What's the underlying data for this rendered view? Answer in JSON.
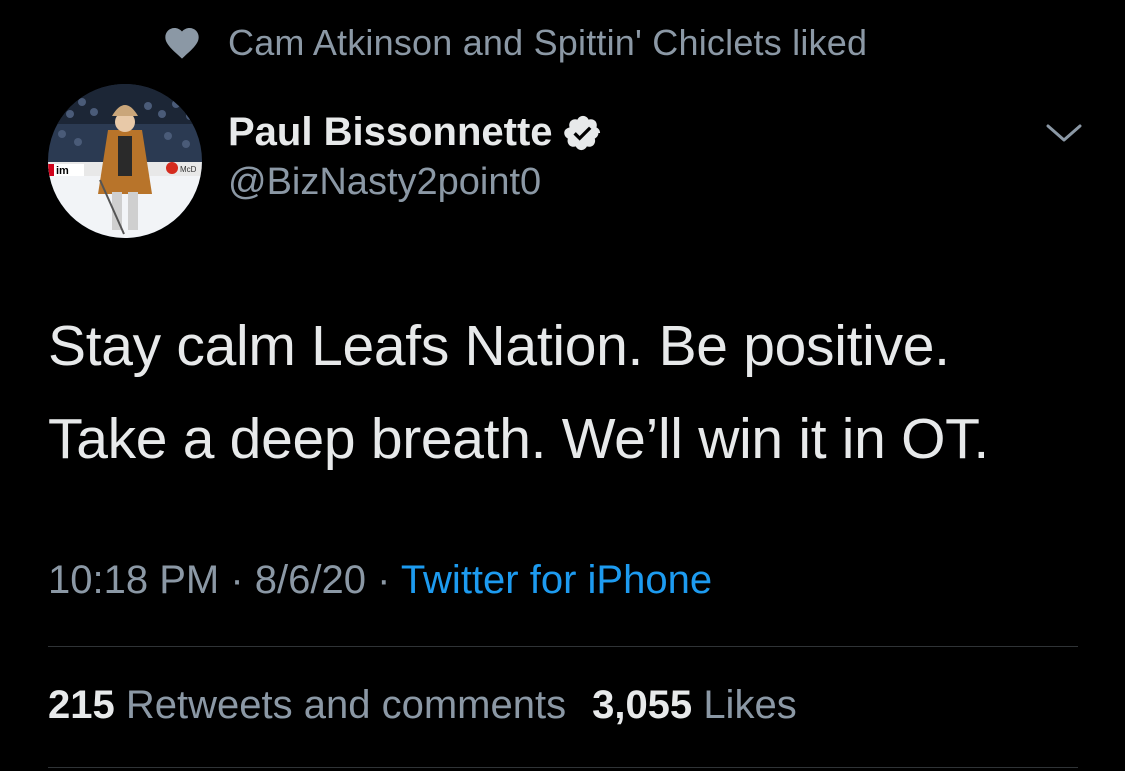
{
  "social_context": {
    "icon": "heart-icon",
    "text": "Cam Atkinson and Spittin' Chiclets liked"
  },
  "author": {
    "display_name": "Paul Bissonnette",
    "handle": "@BizNasty2point0",
    "verified": true
  },
  "tweet": {
    "text_line_1": "Stay calm Leafs Nation. Be positive.",
    "text_line_2": "Take a deep breath. We’ll win it in OT."
  },
  "meta": {
    "time": "10:18 PM",
    "separator": " · ",
    "date": "8/6/20",
    "source": "Twitter for iPhone"
  },
  "stats": {
    "retweets_count": "215",
    "retweets_label": "Retweets and comments",
    "likes_count": "3,055",
    "likes_label": "Likes"
  },
  "avatar_sign_text": "im",
  "avatar_sponsor_text": "McD",
  "colors": {
    "background": "#000000",
    "primary_text": "#e7e9ea",
    "secondary_text": "#8b98a5",
    "link": "#1d9bf0",
    "divider": "#2f3336"
  }
}
